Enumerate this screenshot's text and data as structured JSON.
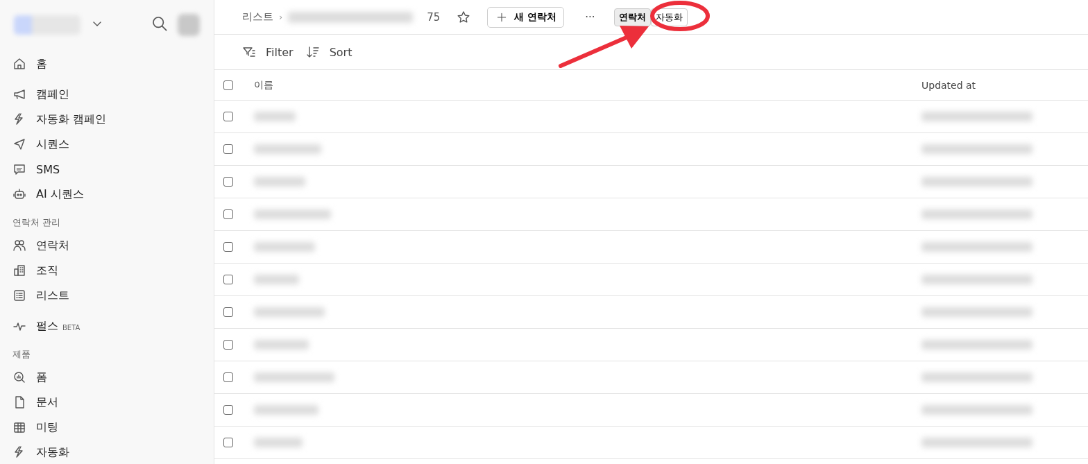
{
  "sidebar": {
    "groups": [
      {
        "items": [
          {
            "label": "홈"
          }
        ]
      },
      {
        "items": [
          {
            "label": "캠페인"
          },
          {
            "label": "자동화 캠페인"
          },
          {
            "label": "시퀀스"
          },
          {
            "label": "SMS"
          },
          {
            "label": "AI 시퀀스"
          }
        ]
      },
      {
        "heading": "연락처 관리",
        "items": [
          {
            "label": "연락처"
          },
          {
            "label": "조직"
          },
          {
            "label": "리스트"
          }
        ]
      },
      {
        "items": [
          {
            "label": "펄스",
            "badge": "BETA"
          }
        ]
      },
      {
        "heading": "제품",
        "items": [
          {
            "label": "폼"
          },
          {
            "label": "문서"
          },
          {
            "label": "미팅"
          },
          {
            "label": "자동화"
          }
        ]
      }
    ]
  },
  "topbar": {
    "breadcrumb": "리스트",
    "separator": "›",
    "count": "75",
    "new_button": "새 연락처",
    "more": "···",
    "tabs": [
      {
        "label": "연락처",
        "selected": true
      },
      {
        "label": "자동화",
        "selected": false
      }
    ]
  },
  "toolbar": {
    "filter": "Filter",
    "sort": "Sort"
  },
  "table": {
    "columns": [
      "이름",
      "Updated at"
    ],
    "header_checked": false,
    "rows": [
      {
        "checked": false
      },
      {
        "checked": false
      },
      {
        "checked": false
      },
      {
        "checked": false
      },
      {
        "checked": false
      },
      {
        "checked": false
      },
      {
        "checked": false
      },
      {
        "checked": false
      },
      {
        "checked": false
      },
      {
        "checked": false
      },
      {
        "checked": false
      }
    ]
  }
}
